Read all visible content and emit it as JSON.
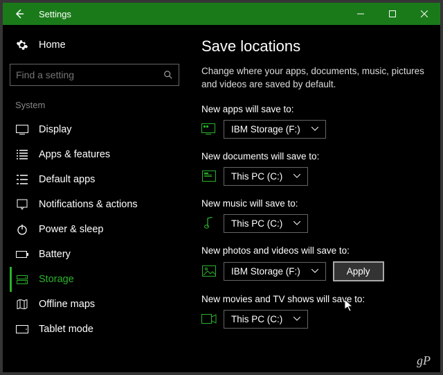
{
  "window": {
    "title": "Settings"
  },
  "sidebar": {
    "home": "Home",
    "search_placeholder": "Find a setting",
    "section": "System",
    "items": [
      {
        "label": "Display"
      },
      {
        "label": "Apps & features"
      },
      {
        "label": "Default apps"
      },
      {
        "label": "Notifications & actions"
      },
      {
        "label": "Power & sleep"
      },
      {
        "label": "Battery"
      },
      {
        "label": "Storage"
      },
      {
        "label": "Offline maps"
      },
      {
        "label": "Tablet mode"
      }
    ]
  },
  "main": {
    "title": "Save locations",
    "description": "Change where your apps, documents, music, pictures and videos are saved by default.",
    "settings": [
      {
        "label": "New apps will save to:",
        "value": "IBM Storage (F:)"
      },
      {
        "label": "New documents will save to:",
        "value": "This PC (C:)"
      },
      {
        "label": "New music will save to:",
        "value": "This PC (C:)"
      },
      {
        "label": "New photos and videos will save to:",
        "value": "IBM Storage (F:)",
        "apply": "Apply"
      },
      {
        "label": "New movies and TV shows will save to:",
        "value": "This PC (C:)"
      }
    ]
  },
  "watermark": "gP"
}
